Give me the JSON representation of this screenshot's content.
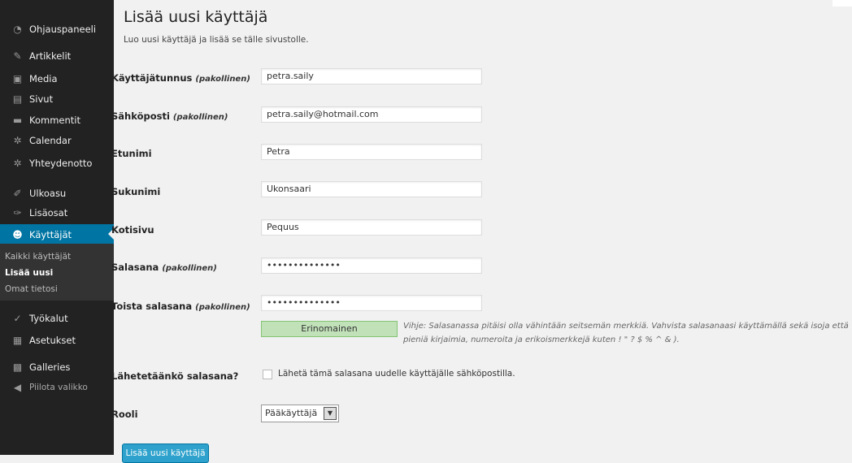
{
  "sidebar": {
    "items": [
      {
        "label": "Ohjauspaneeli",
        "icon": "dashboard-icon"
      },
      {
        "label": "Artikkelit",
        "icon": "pin-icon"
      },
      {
        "label": "Media",
        "icon": "media-icon"
      },
      {
        "label": "Sivut",
        "icon": "page-icon"
      },
      {
        "label": "Kommentit",
        "icon": "comment-icon"
      },
      {
        "label": "Calendar",
        "icon": "gear-icon"
      },
      {
        "label": "Yhteydenotto",
        "icon": "gear-icon"
      },
      {
        "label": "Ulkoasu",
        "icon": "brush-icon"
      },
      {
        "label": "Lisäosat",
        "icon": "plugin-icon"
      },
      {
        "label": "Käyttäjät",
        "icon": "user-icon"
      },
      {
        "label": "Työkalut",
        "icon": "wrench-icon"
      },
      {
        "label": "Asetukset",
        "icon": "settings-icon"
      },
      {
        "label": "Galleries",
        "icon": "gallery-icon"
      },
      {
        "label": "Piilota valikko",
        "icon": "collapse-icon"
      }
    ],
    "submenu": [
      "Kaikki käyttäjät",
      "Lisää uusi",
      "Omat tietosi"
    ]
  },
  "main": {
    "title": "Lisää uusi käyttäjä",
    "subtitle": "Luo uusi käyttäjä ja lisää se tälle sivustolle.",
    "required_suffix": "(pakollinen)",
    "fields": {
      "username": {
        "label": "Käyttäjätunnus",
        "value": "petra.saily"
      },
      "email": {
        "label": "Sähköposti",
        "value": "petra.saily@hotmail.com"
      },
      "firstname": {
        "label": "Etunimi",
        "value": "Petra"
      },
      "lastname": {
        "label": "Sukunimi",
        "value": "Ukonsaari"
      },
      "website": {
        "label": "Kotisivu",
        "value": "Pequus"
      },
      "password": {
        "label": "Salasana",
        "value": "••••••••••••••"
      },
      "password_repeat": {
        "label": "Toista salasana",
        "value": "••••••••••••••"
      }
    },
    "strength": "Erinomainen",
    "hint": "Vihje: Salasanassa pitäisi olla vähintään seitsemän merkkiä. Vahvista salasanaasi käyttämällä sekä isoja että pieniä kirjaimia, numeroita ja erikoismerkkejä kuten ! \" ? $ % ^ & ).",
    "send_password": {
      "label": "Lähetetäänkö salasana?",
      "checkbox_label": "Lähetä tämä salasana uudelle käyttäjälle sähköpostilla.",
      "checked": false
    },
    "role": {
      "label": "Rooli",
      "value": "Pääkäyttäjä"
    },
    "submit": "Lisää uusi käyttäjä"
  },
  "colors": {
    "sidebar": "#222222",
    "active": "#0074a2",
    "button": "#2ea2cc",
    "strength_good": "#c1e1b9"
  }
}
